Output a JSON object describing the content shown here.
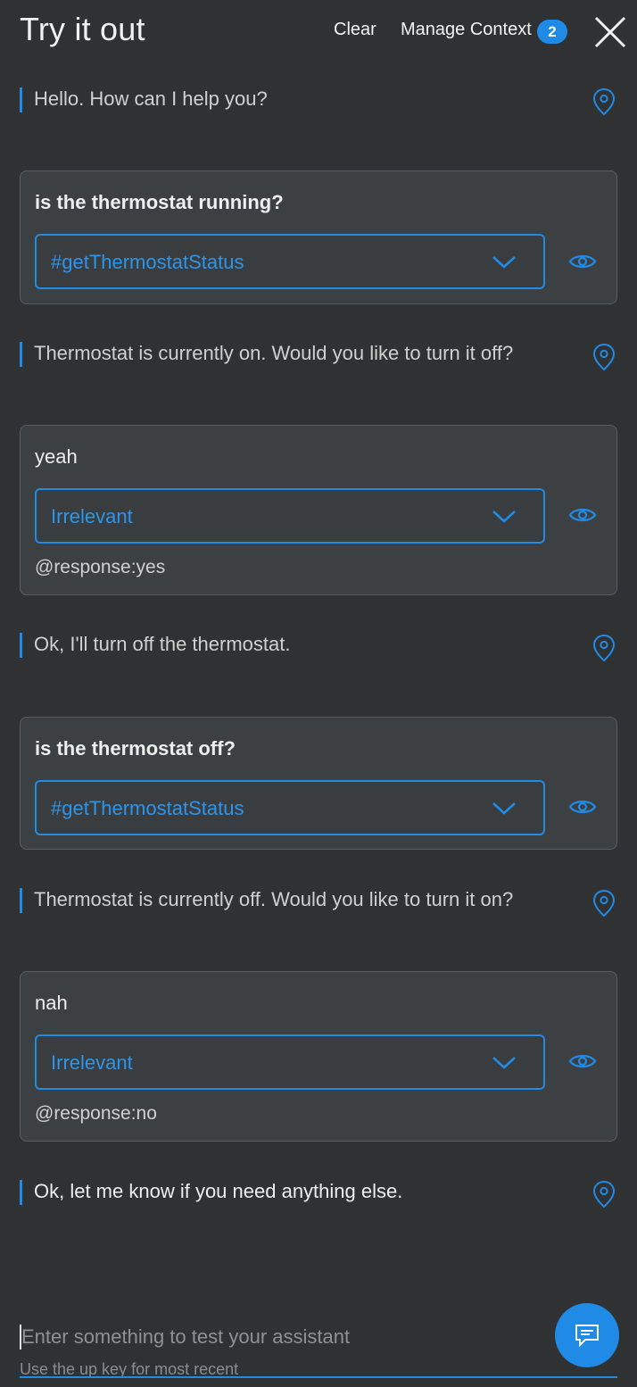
{
  "header": {
    "title": "Try it out",
    "clear_label": "Clear",
    "manage_context_label": "Manage Context",
    "context_count": "2",
    "close_icon": "close-icon"
  },
  "conversation": {
    "bot_1": "Hello. How can I help you?",
    "user_1": {
      "text": "is the thermostat running?",
      "intent": "#getThermostatStatus"
    },
    "bot_2": "Thermostat is currently on. Would you like to turn it off?",
    "user_2": {
      "text": "yeah",
      "intent": "Irrelevant",
      "entity": "@response:yes"
    },
    "bot_3": "Ok, I'll turn off the thermostat.",
    "user_3": {
      "text": "is the thermostat off?",
      "intent": "#getThermostatStatus"
    },
    "bot_4": "Thermostat is currently off. Would you like to turn it on?",
    "user_4": {
      "text": "nah",
      "intent": "Irrelevant",
      "entity": "@response:no"
    },
    "bot_5": "Ok, let me know if you need anything else."
  },
  "input": {
    "placeholder": "Enter something to test your assistant",
    "hint": "Use the up key for most recent"
  },
  "colors": {
    "background": "#303132",
    "card": "#3d4043",
    "accent": "#1f8be6"
  },
  "icons": {
    "location": "location-pin-icon",
    "eye": "eye-icon",
    "chevron": "chevron-down-icon",
    "chat": "chat-bubble-icon"
  }
}
